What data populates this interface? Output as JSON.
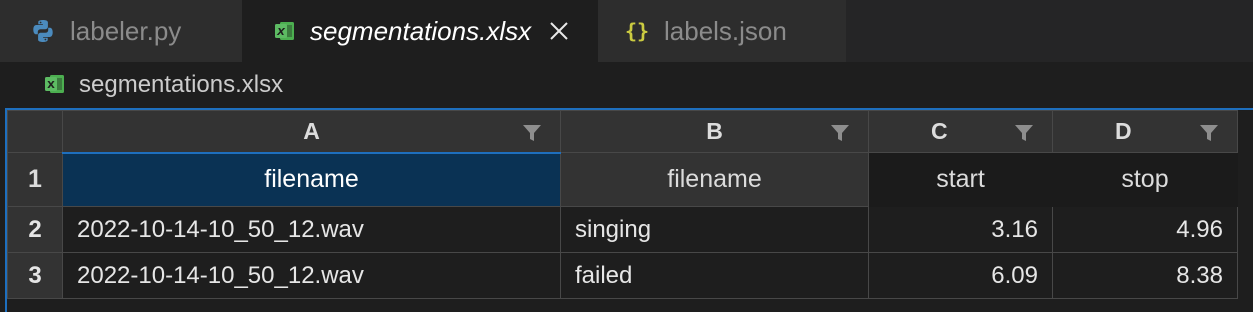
{
  "tabs": [
    {
      "label": "labeler.py",
      "icon": "python-icon",
      "active": false
    },
    {
      "label": "segmentations.xlsx",
      "icon": "excel-icon",
      "active": true
    },
    {
      "label": "labels.json",
      "icon": "json-braces-icon",
      "active": false
    }
  ],
  "breadcrumb": {
    "label": "segmentations.xlsx",
    "icon": "excel-icon"
  },
  "sheet": {
    "columns": [
      "A",
      "B",
      "C",
      "D"
    ],
    "rows": [
      {
        "num": "1",
        "cells": [
          "filename",
          "filename",
          "start",
          "stop"
        ]
      },
      {
        "num": "2",
        "cells": [
          "2022-10-14-10_50_12.wav",
          "singing",
          "3.16",
          "4.96"
        ]
      },
      {
        "num": "3",
        "cells": [
          "2022-10-14-10_50_12.wav",
          "failed",
          "6.09",
          "8.38"
        ]
      }
    ]
  },
  "colors": {
    "accent": "#1e6fbe",
    "selected_cell_bg": "#0a3254",
    "excel_green": "#4caf50",
    "json_yellow": "#cbcb41",
    "python_blue": "#4b8bbe"
  }
}
